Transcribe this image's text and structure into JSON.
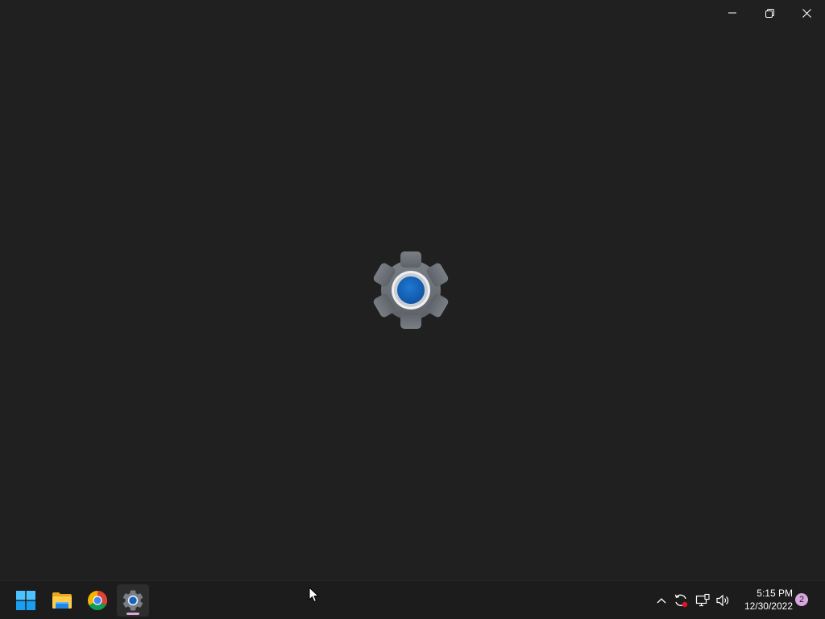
{
  "window": {
    "title": "Settings",
    "caption_buttons": [
      "minimize",
      "restore",
      "close"
    ]
  },
  "splash": {
    "icon": "settings-gear-icon",
    "accent": "#1565c0"
  },
  "taskbar": {
    "apps": [
      {
        "name": "Start",
        "icon": "windows-start-icon",
        "active": false
      },
      {
        "name": "File Explorer",
        "icon": "file-explorer-icon",
        "active": false
      },
      {
        "name": "Google Chrome",
        "icon": "chrome-icon",
        "active": false
      },
      {
        "name": "Settings",
        "icon": "settings-gear-icon",
        "active": true
      }
    ],
    "tray": {
      "icons": [
        "chevron-up-icon",
        "sync-icon",
        "network-icon",
        "volume-icon"
      ],
      "time": "5:15 PM",
      "date": "12/30/2022",
      "notification_count": "2"
    }
  },
  "colors": {
    "background": "#202020",
    "taskbar": "#1c1c1c",
    "active_indicator": "#e3a8d8",
    "badge": "#d9a6e0"
  }
}
